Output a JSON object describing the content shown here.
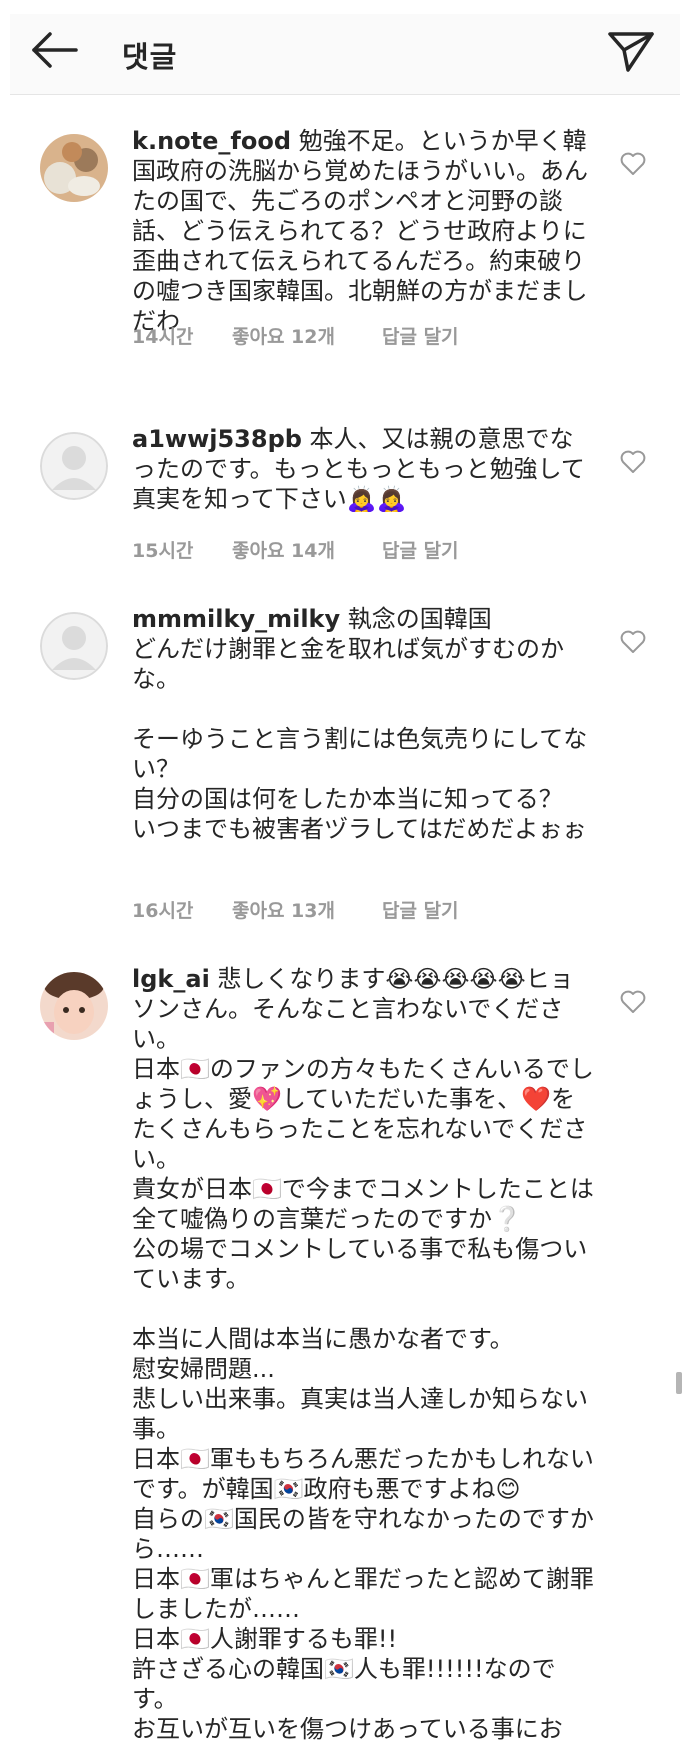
{
  "header": {
    "title": "댓글",
    "back_icon": "arrow-left-icon",
    "send_icon": "paper-plane-icon"
  },
  "colors": {
    "text": "#262626",
    "meta": "#999999",
    "header_bg": "#fafafa"
  },
  "comments": [
    {
      "username": "k.note_food",
      "text": " 勉強不足。というか早く韓国政府の洗脳から覚めたほうがいい。あんたの国で、先ごろのポンペオと河野の談話、どう伝えられてる？どうせ政府よりに歪曲されて伝えられてるんだろ。約束破りの嘘つき国家韓国。北朝鮮の方がまだましだわ",
      "time": "14시간",
      "likes": "좋아요 12개",
      "reply": "답글 달기"
    },
    {
      "username": "a1wwj538pb",
      "text": " 本人、又は親の意思でなったのです。もっともっともっと勉強して真実を知って下さい🙇‍♀️🙇‍♀️",
      "time": "15시간",
      "likes": "좋아요 14개",
      "reply": "답글 달기"
    },
    {
      "username": "mmmilky_milky",
      "text": " 執念の国韓国\nどんだけ謝罪と金を取れば気がすむのかな。\n\nそーゆうこと言う割には色気売りにしてない？\n自分の国は何をしたか本当に知ってる？\nいつまでも被害者ヅラしてはだめだよぉぉ",
      "time": "16시간",
      "likes": "좋아요 13개",
      "reply": "답글 달기"
    },
    {
      "username": "lgk_ai",
      "text": " 悲しくなります😭😭😭😭😭ヒョソンさん。そんなこと言わないでください。\n日本🇯🇵のファンの方々もたくさんいるでしょうし、愛💖していただいた事を、❤️をたくさんもらったことを忘れないでください。\n貴女が日本🇯🇵で今までコメントしたことは全て嘘偽りの言葉だったのですか❔\n公の場でコメントしている事で私も傷ついています。\n\n本当に人間は本当に愚かな者です。\n慰安婦問題...\n悲しい出来事。真実は当人達しか知らない事。\n日本🇯🇵軍ももちろん悪だったかもしれないです。が韓国🇰🇷政府も悪ですよね😊\n自らの🇰🇷国民の皆を守れなかったのですから……\n日本🇯🇵軍はちゃんと罪だったと認めて謝罪しましたが……\n日本🇯🇵人謝罪するも罪!!\n許さざる心の韓国🇰🇷人も罪!!!!!!なのです。\nお互いが互いを傷つけあっている事にお"
    }
  ]
}
